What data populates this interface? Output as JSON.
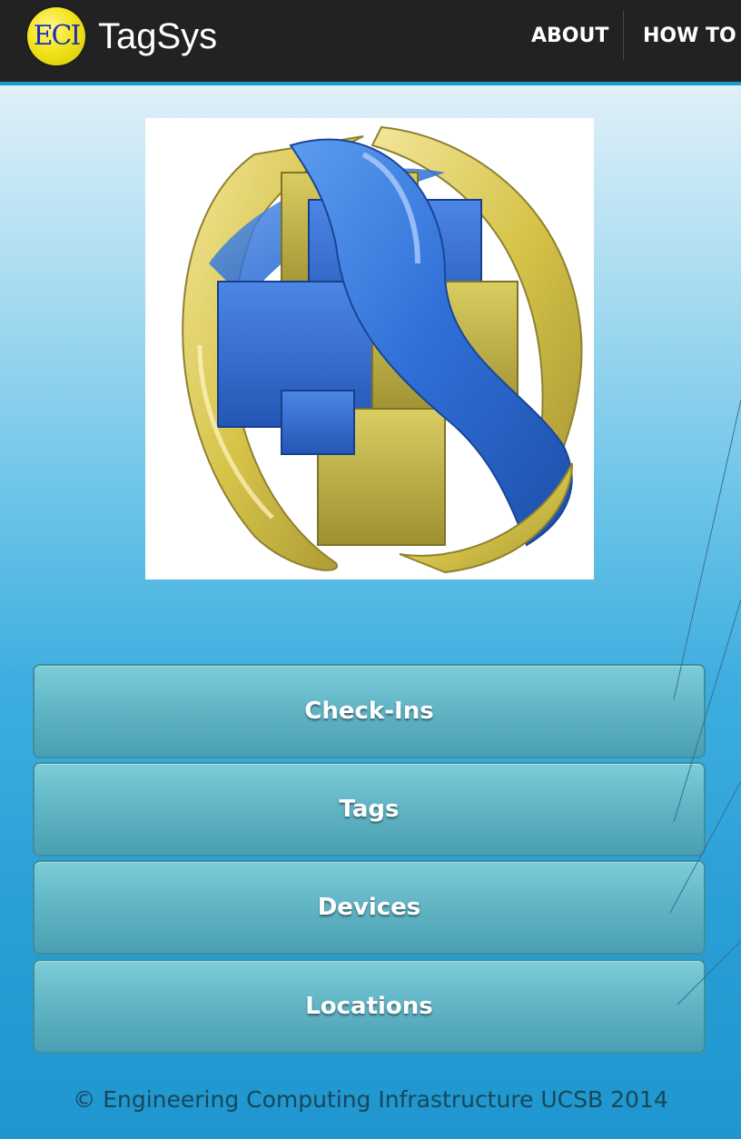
{
  "app_bar": {
    "logo_text": "ECI",
    "title": "TagSys",
    "actions": [
      "ABOUT",
      "HOW TO"
    ]
  },
  "menu": {
    "buttons": [
      "Check-Ins",
      "Tags",
      "Devices",
      "Locations"
    ]
  },
  "footer": {
    "text": "© Engineering Computing Infrastructure UCSB 2014"
  },
  "colors": {
    "app_bar": "#222222",
    "accent": "#1b9ad0",
    "button": "#62b6c6",
    "logo_yellow": "#f2e51c",
    "logo_blue": "#1e2fb5",
    "ribbon_blue": "#2f6fd6",
    "ribbon_gold": "#d8c64e"
  },
  "icons": {
    "hero": "blue-and-gold-ribbon-sphere-with-cubes-logo"
  }
}
